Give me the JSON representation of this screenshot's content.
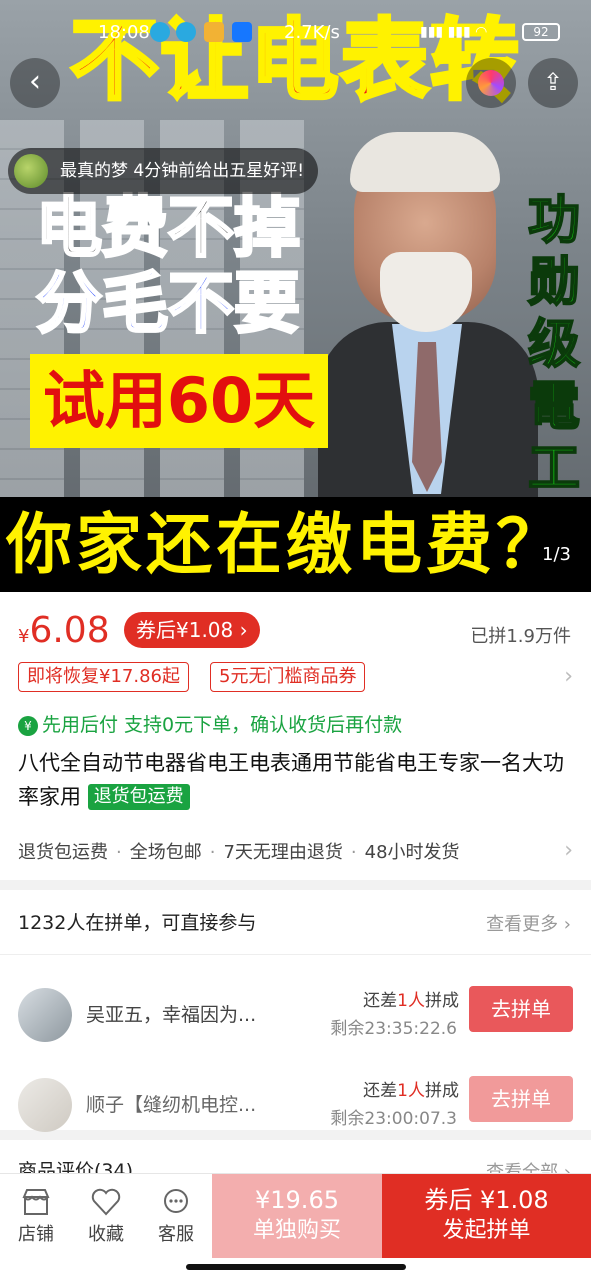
{
  "status_bar": {
    "time": "18:08",
    "speed": "2.7K/s",
    "battery": "92"
  },
  "hero": {
    "headline": "不让电表转",
    "line1": "电费不掉",
    "line2": "分毛不要",
    "line3": "试用60天",
    "side_text": "功勋级電工",
    "bottom_text": "你家还在缴电费？",
    "counter": "1/3"
  },
  "review_pill": {
    "text": "最真的梦 4分钟前给出五星好评!"
  },
  "price": {
    "currency": "¥",
    "value": "6.08",
    "coupon_label": "券后¥1.08",
    "sold": "已拼1.9万件",
    "tags": [
      "即将恢复¥17.86起",
      "5元无门槛商品券"
    ]
  },
  "paylater": "先用后付 支持0元下单，确认收货后再付款",
  "product": {
    "title": "八代全自动节电器省电王电表通用节能省电王专家一名大功率家用",
    "badge": "退货包运费"
  },
  "services": [
    "退货包运费",
    "全场包邮",
    "7天无理由退货",
    "48小时发货"
  ],
  "group": {
    "heading": "1232人在拼单，可直接参与",
    "more": "查看更多",
    "rows": [
      {
        "name": "吴亚五，幸福因为...",
        "lack_prefix": "还差",
        "lack_num": "1人",
        "lack_suffix": "拼成",
        "remain": "剩余23:35:22.6",
        "button": "去拼单"
      },
      {
        "name": "顺子【缝纫机电控...",
        "lack_prefix": "还差",
        "lack_num": "1人",
        "lack_suffix": "拼成",
        "remain": "剩余23:00:07.3",
        "button": "去拼单"
      }
    ]
  },
  "reviews": {
    "title": "商品评价(34)",
    "more": "查看全部"
  },
  "bottom_bar": {
    "shop": "店铺",
    "fav": "收藏",
    "service": "客服",
    "solo_price": "¥19.65",
    "solo_label": "单独购买",
    "group_price": "券后 ¥1.08",
    "group_label": "发起拼单"
  },
  "colors": {
    "accent": "#e02e24",
    "green": "#1aa341"
  }
}
